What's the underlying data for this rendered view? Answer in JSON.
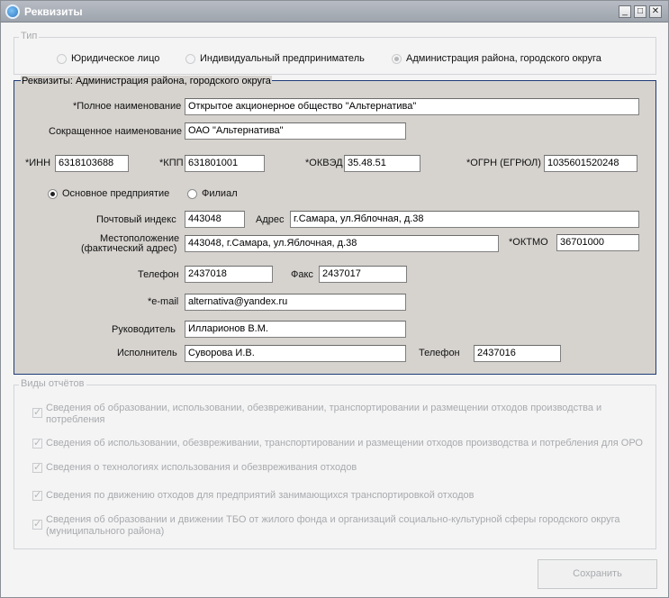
{
  "window": {
    "title": "Реквизиты",
    "min_glyph": "_",
    "max_glyph": "□",
    "close_glyph": "✕"
  },
  "type_group": {
    "legend": "Тип",
    "options": [
      {
        "label": "Юридическое лицо",
        "selected": false
      },
      {
        "label": "Индивидуальный предприниматель",
        "selected": false
      },
      {
        "label": "Администрация района, городского округа",
        "selected": true
      }
    ]
  },
  "requisites": {
    "legend": "Реквизиты: Администрация района, городского округа",
    "full_name_label": "*Полное наименование",
    "full_name_value": "Открытое акционерное общество \"Альтернатива\"",
    "short_name_label": "Сокращенное наименование",
    "short_name_value": "ОАО \"Альтернатива\"",
    "inn_label": "*ИНН",
    "inn_value": "6318103688",
    "kpp_label": "*КПП",
    "kpp_value": "631801001",
    "okved_label": "*ОКВЭД",
    "okved_value": "35.48.51",
    "ogrn_label": "*ОГРН (ЕГРЮЛ)",
    "ogrn_value": "1035601520248",
    "main_enterprise_label": "Основное предприятие",
    "branch_label": "Филиал",
    "postal_index_label": "Почтовый индекс",
    "postal_index_value": "443048",
    "address_label": "Адрес",
    "address_value": "г.Самара, ул.Яблочная, д.38",
    "location_label_line1": "Местоположение",
    "location_label_line2": "(фактический адрес)",
    "location_value": "443048, г.Самара, ул.Яблочная, д.38",
    "oktmo_label": "*ОКТМО",
    "oktmo_value": "36701000",
    "phone_label": "Телефон",
    "phone_value": "2437018",
    "fax_label": "Факс",
    "fax_value": "2437017",
    "email_label": "*e-mail",
    "email_value": "alternativa@yandex.ru",
    "head_label": "Руководитель",
    "head_value": "Илларионов В.М.",
    "executor_label": "Исполнитель",
    "executor_value": "Суворова И.В.",
    "executor_phone_label": "Телефон",
    "executor_phone_value": "2437016"
  },
  "reports_group": {
    "legend": "Виды отчётов",
    "items": [
      {
        "line1": "Сведения об образовании,  использовании, обезвреживании, транспортировании и размещении отходов производства и",
        "line2": "потребления"
      },
      {
        "line1": "Сведения об использовании, обезвреживании, транспортировании и размещении отходов производства и потребления для ОРО",
        "line2": ""
      },
      {
        "line1": "Сведения о технологиях использования и обезвреживания отходов",
        "line2": ""
      },
      {
        "line1": "Сведения по движению отходов для предприятий занимающихся транспортировкой отходов",
        "line2": ""
      },
      {
        "line1": "Сведения об образовании и движении ТБО от жилого фонда и организаций социально-культурной сферы городского округа",
        "line2": "(муниципального района)"
      }
    ]
  },
  "footer": {
    "save_label": "Сохранить"
  }
}
